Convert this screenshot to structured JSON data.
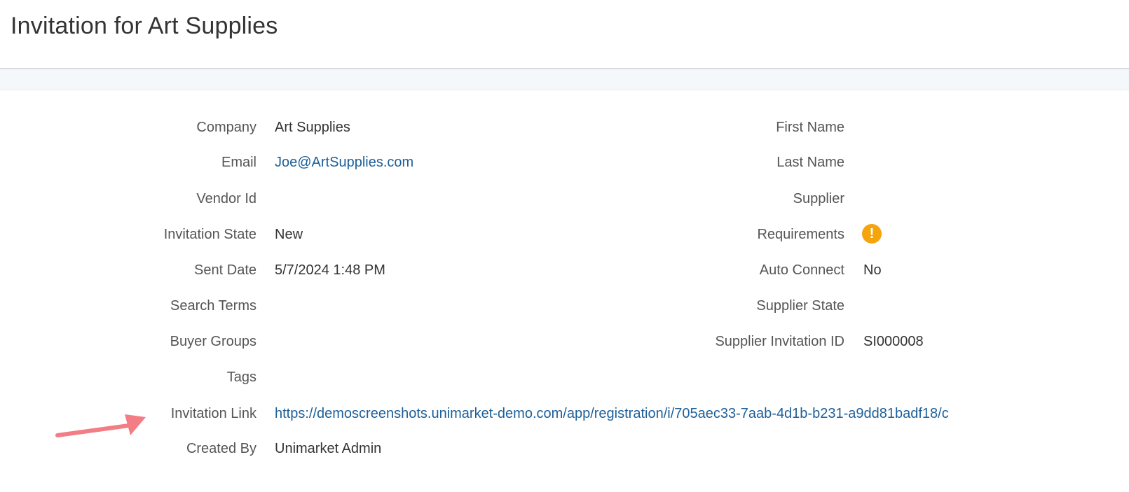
{
  "page": {
    "title": "Invitation for Art Supplies"
  },
  "left_fields": {
    "company": {
      "label": "Company",
      "value": "Art Supplies"
    },
    "email": {
      "label": "Email",
      "value": "Joe@ArtSupplies.com"
    },
    "vendor_id": {
      "label": "Vendor Id",
      "value": ""
    },
    "invitation_state": {
      "label": "Invitation State",
      "value": "New"
    },
    "sent_date": {
      "label": "Sent Date",
      "value": "5/7/2024 1:48 PM"
    },
    "search_terms": {
      "label": "Search Terms",
      "value": ""
    },
    "buyer_groups": {
      "label": "Buyer Groups",
      "value": ""
    },
    "tags": {
      "label": "Tags",
      "value": ""
    },
    "invitation_link": {
      "label": "Invitation Link",
      "value": "https://demoscreenshots.unimarket-demo.com/app/registration/i/705aec33-7aab-4d1b-b231-a9dd81badf18/c"
    },
    "created_by": {
      "label": "Created By",
      "value": "Unimarket Admin"
    }
  },
  "right_fields": {
    "first_name": {
      "label": "First Name",
      "value": ""
    },
    "last_name": {
      "label": "Last Name",
      "value": ""
    },
    "supplier": {
      "label": "Supplier",
      "value": ""
    },
    "requirements": {
      "label": "Requirements",
      "icon": "warning-exclamation-icon",
      "icon_color": "#f5a40c"
    },
    "auto_connect": {
      "label": "Auto Connect",
      "value": "No"
    },
    "supplier_state": {
      "label": "Supplier State",
      "value": ""
    },
    "supplier_invitation_id": {
      "label": "Supplier Invitation ID",
      "value": "SI000008"
    }
  },
  "annotation": {
    "icon": "pointer-arrow-icon",
    "color": "#f47c84"
  },
  "colors": {
    "link": "#1d5f99",
    "label": "#555555",
    "header_border": "#d6dadf",
    "band": "#f5f8fb"
  }
}
